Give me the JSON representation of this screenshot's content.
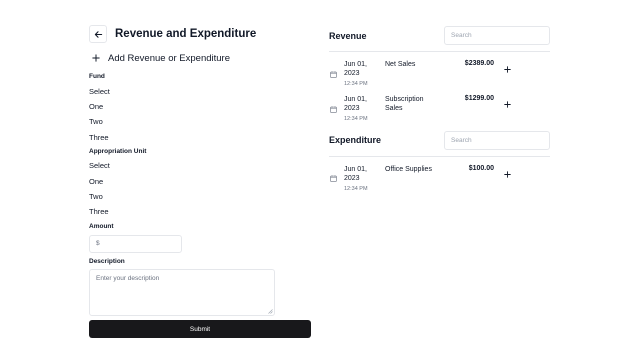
{
  "left": {
    "title": "Revenue and Expenditure",
    "add_title": "Add Revenue or Expenditure",
    "fund": {
      "label": "Fund",
      "options": [
        "Select",
        "One",
        "Two",
        "Three"
      ]
    },
    "appropriation": {
      "label": "Appropriation Unit",
      "options": [
        "Select",
        "One",
        "Two",
        "Three"
      ]
    },
    "amount": {
      "label": "Amount",
      "placeholder": "$"
    },
    "description": {
      "label": "Description",
      "placeholder": "Enter your description"
    },
    "submit_label": "Submit"
  },
  "revenue": {
    "title": "Revenue",
    "search_placeholder": "Search",
    "rows": [
      {
        "date_line1": "Jun 01,",
        "date_line2": "2023",
        "time": "12:34 PM",
        "desc_line1": "Net Sales",
        "desc_line2": "",
        "amount": "$2389.00"
      },
      {
        "date_line1": "Jun 01,",
        "date_line2": "2023",
        "time": "12:34 PM",
        "desc_line1": "Subscription",
        "desc_line2": "Sales",
        "amount": "$1299.00"
      }
    ]
  },
  "expenditure": {
    "title": "Expenditure",
    "search_placeholder": "Search",
    "rows": [
      {
        "date_line1": "Jun 01,",
        "date_line2": "2023",
        "time": "12:34 PM",
        "desc_line1": "Office Supplies",
        "desc_line2": "",
        "amount": "$100.00"
      }
    ]
  },
  "icons": {
    "back": "arrow-left-icon",
    "add": "plus-icon",
    "calendar": "calendar-icon",
    "row_add": "plus-icon"
  },
  "colors": {
    "submit_bg": "#18181b",
    "border": "#e5e7eb",
    "muted_text": "#6b7280"
  }
}
